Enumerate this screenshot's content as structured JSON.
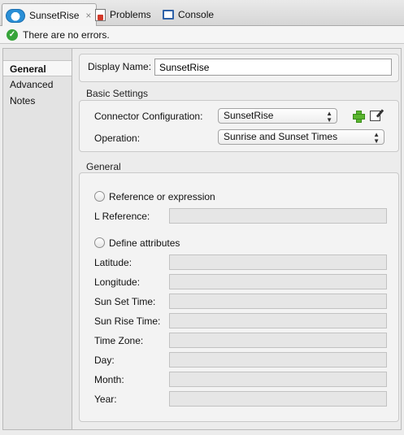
{
  "tabs": {
    "editor": "SunsetRise",
    "close_glyph": "×",
    "problems": "Problems",
    "console": "Console"
  },
  "status": {
    "message": "There are no errors."
  },
  "nav": {
    "items": [
      "General",
      "Advanced",
      "Notes"
    ]
  },
  "form": {
    "display_name_label": "Display Name:",
    "display_name_value": "SunsetRise",
    "basic_settings_title": "Basic Settings",
    "connector_label": "Connector Configuration:",
    "connector_value": "SunsetRise",
    "operation_label": "Operation:",
    "operation_value": "Sunrise and Sunset Times",
    "general_title": "General",
    "reference_option": "Reference or expression",
    "l_reference_label": "L Reference:",
    "define_option": "Define attributes",
    "fields": [
      "Latitude:",
      "Longitude:",
      "Sun Set Time:",
      "Sun Rise Time:",
      "Time Zone:",
      "Day:",
      "Month:",
      "Year:"
    ]
  },
  "icons": {
    "editor_tab": "cloud-icon",
    "problems_tab": "problems-icon",
    "console_tab": "console-icon",
    "status": "check-circle-icon",
    "add": "plus-icon",
    "edit": "edit-icon"
  }
}
